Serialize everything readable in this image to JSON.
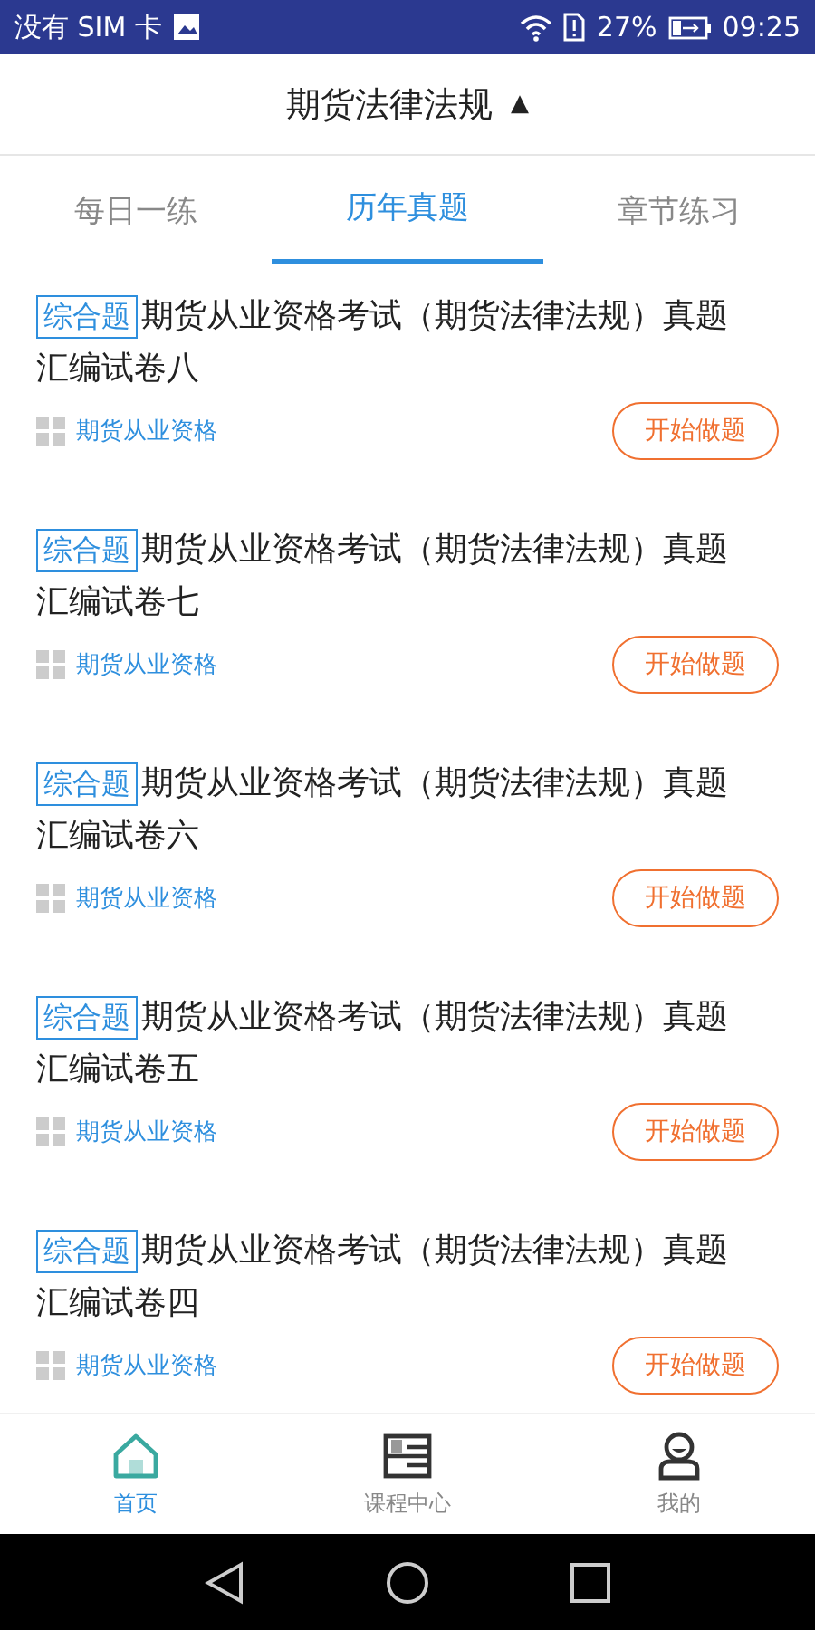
{
  "status_bar": {
    "carrier": "没有 SIM 卡",
    "battery": "27%",
    "time": "09:25"
  },
  "header": {
    "title": "期货法律法规",
    "caret": "▲"
  },
  "tabs": [
    {
      "label": "每日一练",
      "selected": false
    },
    {
      "label": "历年真题",
      "selected": true
    },
    {
      "label": "章节练习",
      "selected": false
    }
  ],
  "papers": [
    {
      "tag": "综合题",
      "title": "期货从业资格考试（期货法律法规）真题汇编试卷八",
      "category": "期货从业资格",
      "action": "开始做题"
    },
    {
      "tag": "综合题",
      "title": "期货从业资格考试（期货法律法规）真题汇编试卷七",
      "category": "期货从业资格",
      "action": "开始做题"
    },
    {
      "tag": "综合题",
      "title": "期货从业资格考试（期货法律法规）真题汇编试卷六",
      "category": "期货从业资格",
      "action": "开始做题"
    },
    {
      "tag": "综合题",
      "title": "期货从业资格考试（期货法律法规）真题汇编试卷五",
      "category": "期货从业资格",
      "action": "开始做题"
    },
    {
      "tag": "综合题",
      "title": "期货从业资格考试（期货法律法规）真题汇编试卷四",
      "category": "期货从业资格",
      "action": "开始做题"
    }
  ],
  "bottom_nav": [
    {
      "label": "首页",
      "kind": "home",
      "selected": true
    },
    {
      "label": "课程中心",
      "kind": "book",
      "selected": false
    },
    {
      "label": "我的",
      "kind": "user",
      "selected": false
    }
  ]
}
